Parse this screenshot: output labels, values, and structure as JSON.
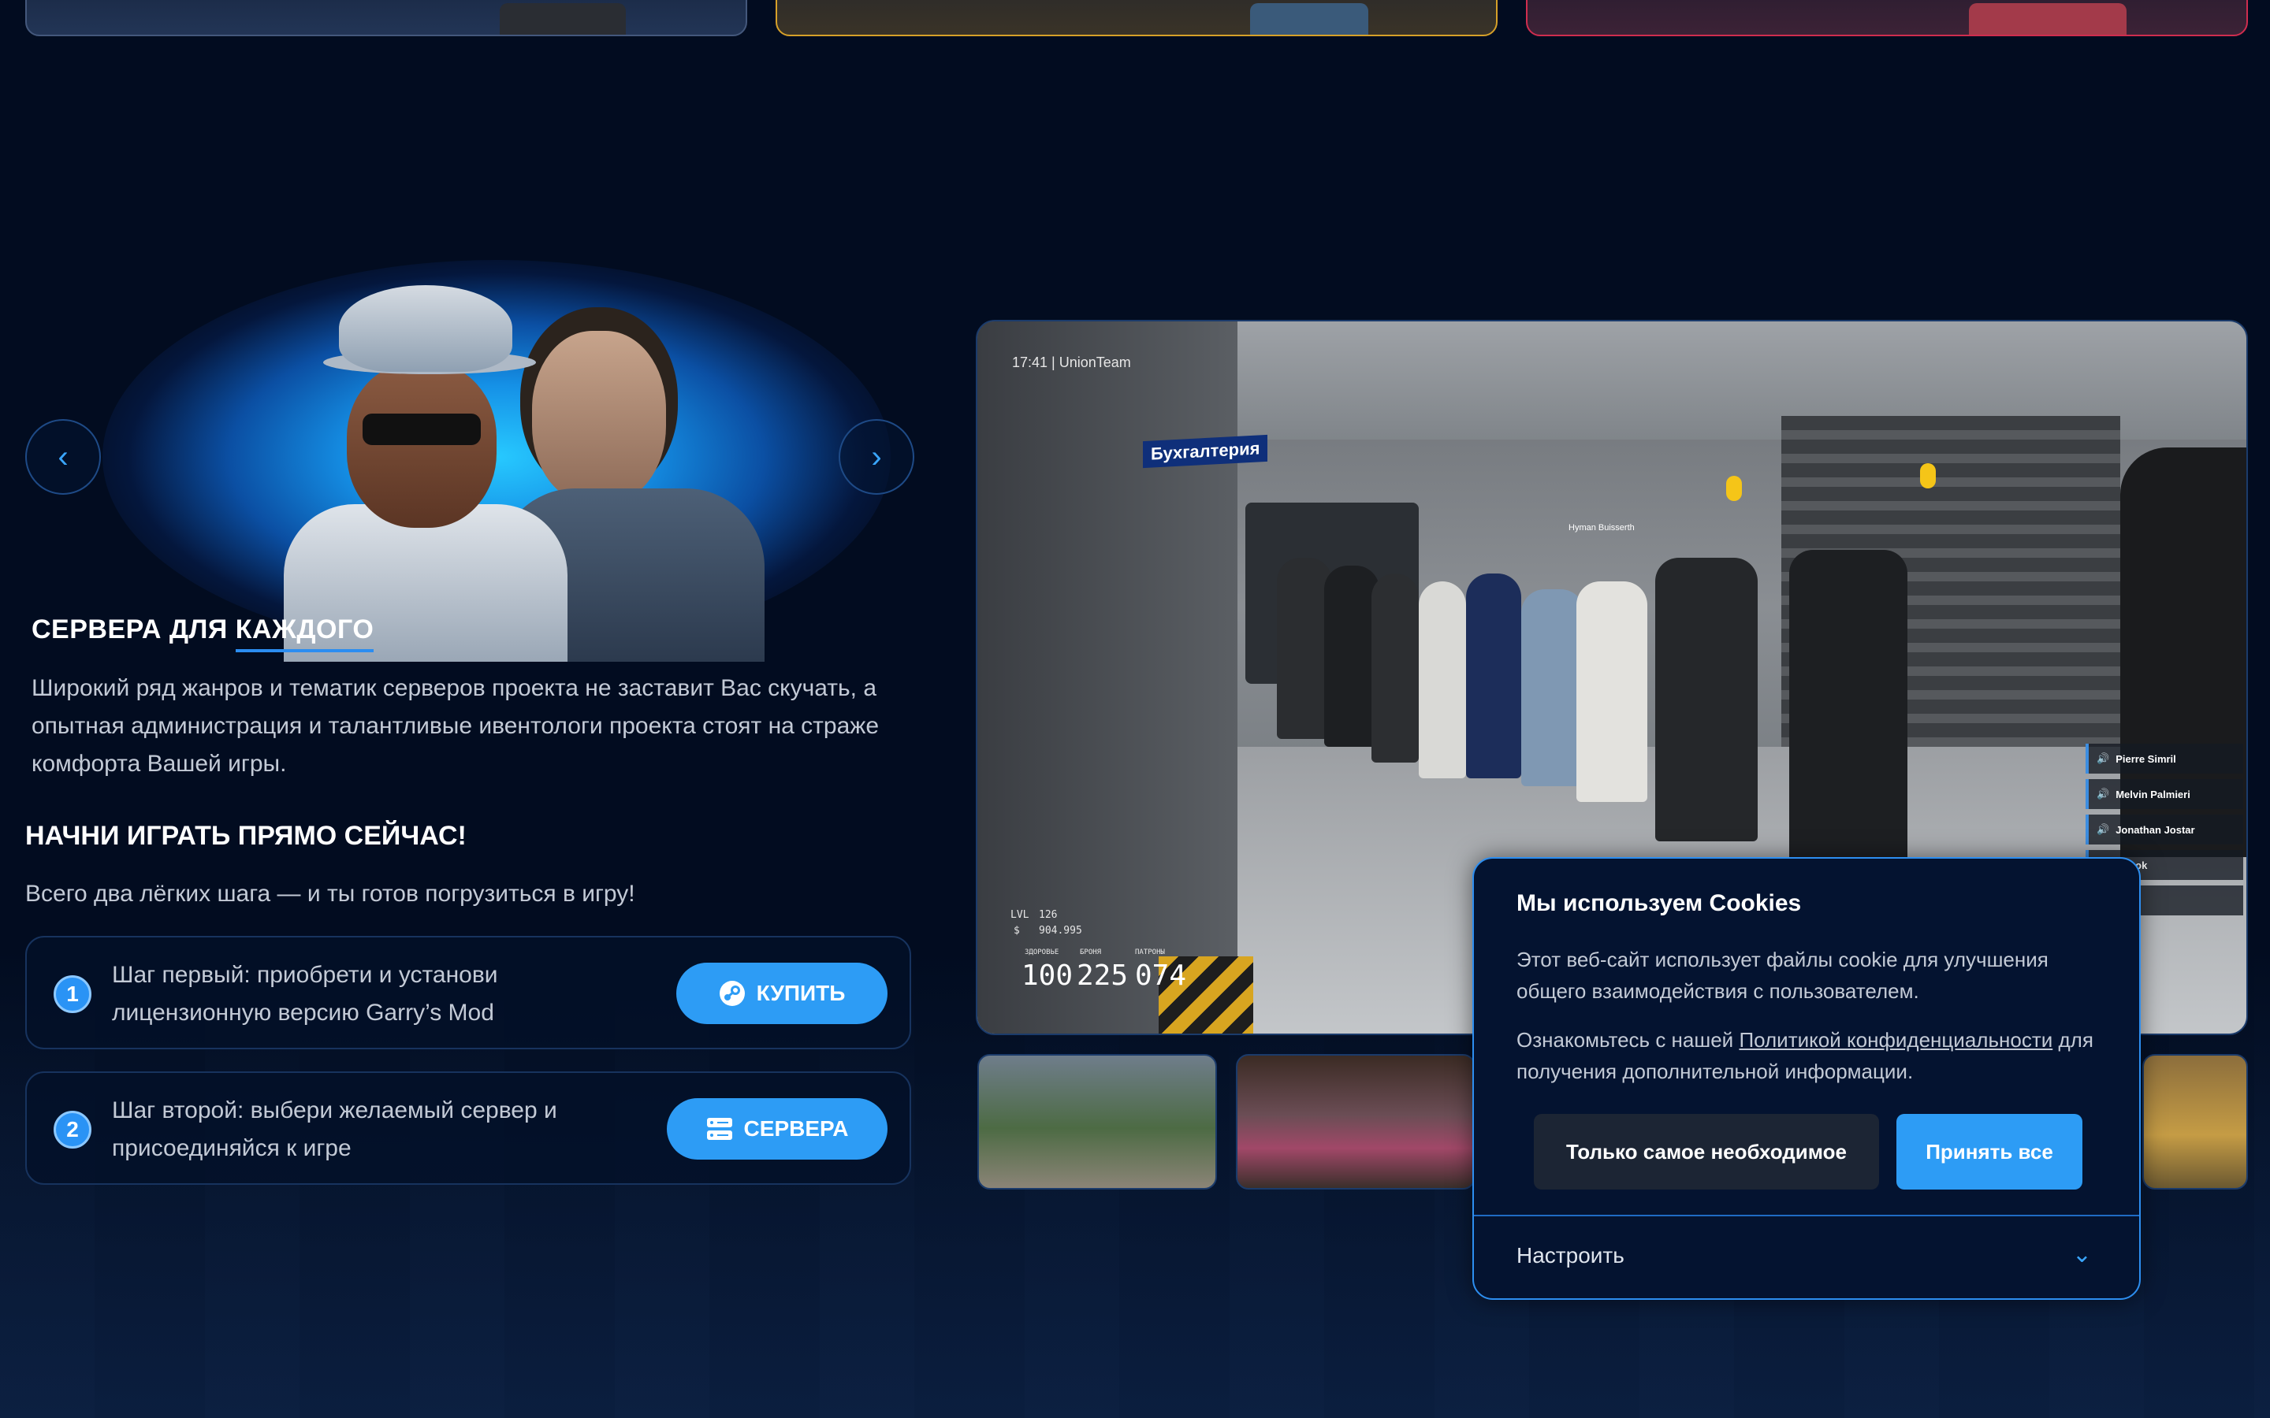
{
  "section": {
    "title_part1": "СЕРВЕРА ДЛЯ ",
    "title_part2": "КАЖДОГО",
    "description": "Широкий ряд жанров и тематик серверов проекта не заставит Вас скучать, а опытная администрация и талантливые ивентологи проекта стоят на страже комфорта Вашей игры."
  },
  "start": {
    "title": "НАЧНИ ИГРАТЬ ПРЯМО СЕЙЧАС!",
    "subtitle": "Всего два лёгких шага — и ты готов погрузиться в игру!",
    "steps": [
      {
        "number": "1",
        "text": "Шаг первый: приобрети и установи лицензионную версию Garry’s Mod",
        "button": "КУПИТЬ",
        "icon": "steam-icon"
      },
      {
        "number": "2",
        "text": "Шаг второй: выбери желаемый сервер и присоединяйся к игре",
        "button": "СЕРВЕРА",
        "icon": "server-icon"
      }
    ]
  },
  "carousel": {
    "prev_icon": "chevron-left-icon",
    "next_icon": "chevron-right-icon"
  },
  "screenshot": {
    "hud_time": "17:41 | UnionTeam",
    "sign": "Бухгалтерия",
    "player_tag": "Hyman Buisserth",
    "level_label": "LVL",
    "level": "126",
    "money_label": "$",
    "money": "904.995",
    "labels": [
      "ЗДОРОВЬЕ",
      "БРОНЯ",
      "ПАТРОНЫ"
    ],
    "health": "100",
    "armor": "225",
    "ammo": "074",
    "voice": [
      "Pierre Simril",
      "Melvin Palmieri",
      "Jonathan Jostar",
      "r Stayrook",
      "red"
    ]
  },
  "cookie": {
    "title": "Мы используем Cookies",
    "text1": "Этот веб-сайт использует файлы cookie для улучшения общего взаимодействия с пользователем.",
    "text2_prefix": "Ознакомьтесь с нашей ",
    "link": "Политикой конфиденциальности",
    "text2_suffix": " для получения дополнительной информации.",
    "btn_necessary": "Только самое необходимое",
    "btn_accept": "Принять все",
    "settings": "Настроить",
    "accent": "#2d9cf5"
  }
}
